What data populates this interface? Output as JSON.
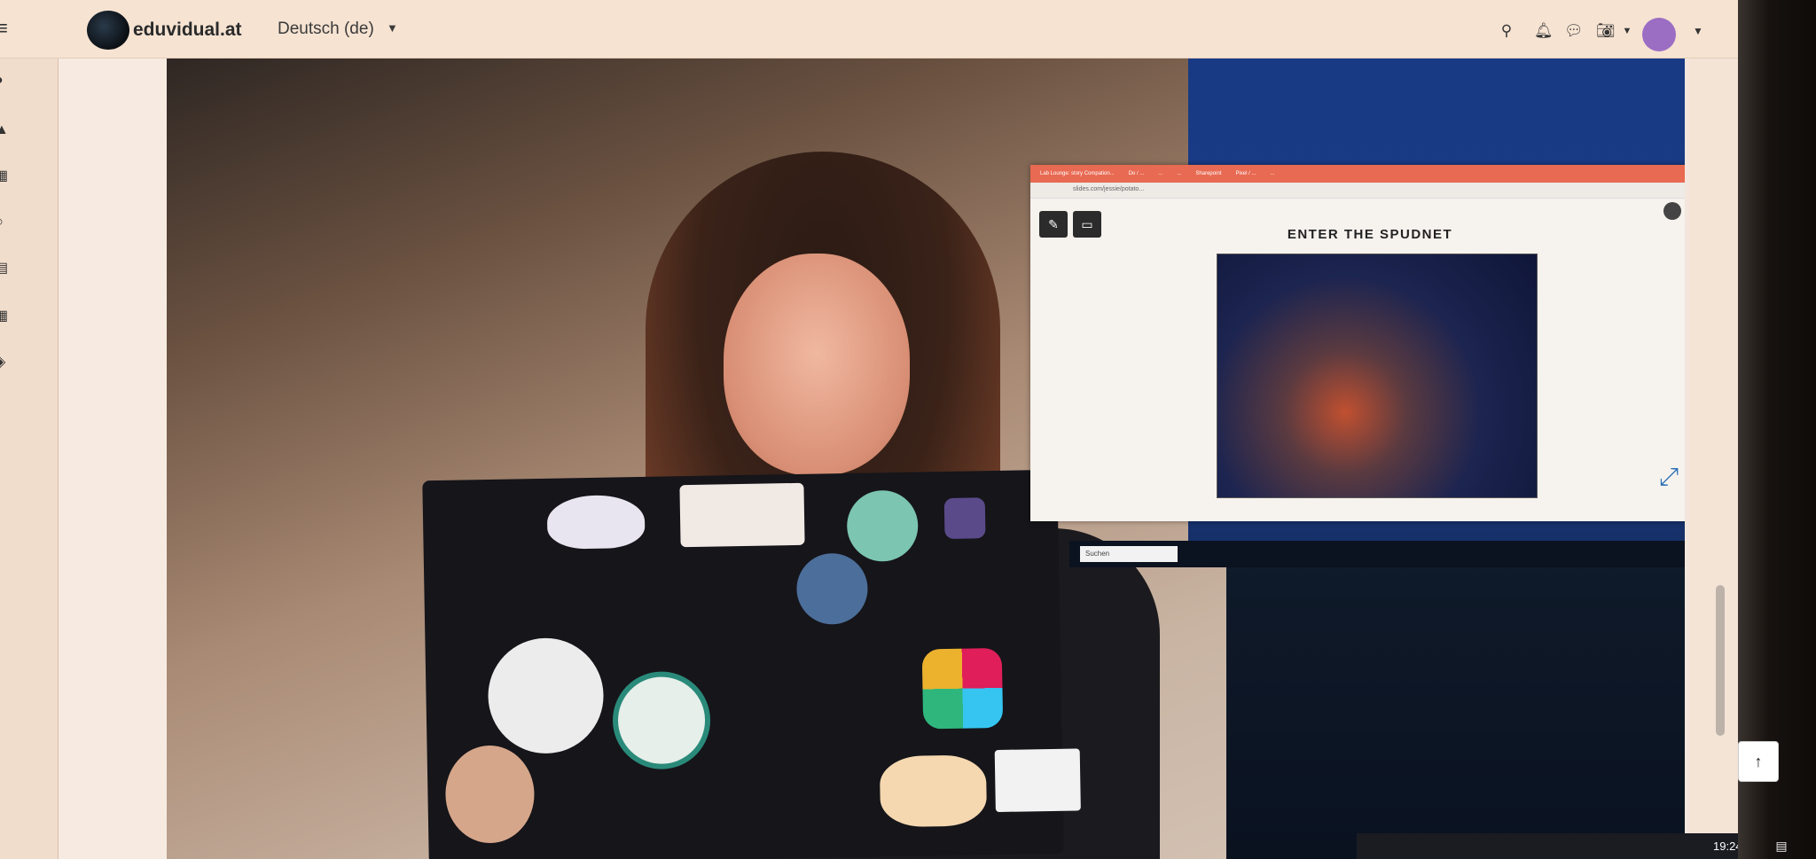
{
  "topbar": {
    "brand": "eduvidual.at",
    "language": "Deutsch (de)",
    "icons": [
      "menu-icon",
      "search-icon",
      "bell-icon",
      "messages-icon",
      "camera-icon",
      "user-avatar"
    ]
  },
  "drawer": {
    "icons": [
      "home-icon",
      "graduation-cap-icon",
      "calendar-icon",
      "circle-icon",
      "file-icon",
      "grid-icon",
      "badge-icon"
    ]
  },
  "shared_screen": {
    "tabs": [
      "Lab Lounge: story Compation...",
      "Do / ...",
      "...",
      "...",
      "Sharepoint",
      "Pixel / ...",
      "..."
    ],
    "url": "slides.com/jessie/potato...",
    "slide_title": "ENTER THE SPUDNET",
    "search_placeholder": "Suchen"
  },
  "taskbar": {
    "time": "19:24"
  },
  "colors": {
    "topbar_bg": "#f6e3d2",
    "accent_avatar": "#9b6ec4",
    "shared_tabbar": "#e86a52",
    "fullscreen_icon": "#2a6fb5"
  }
}
